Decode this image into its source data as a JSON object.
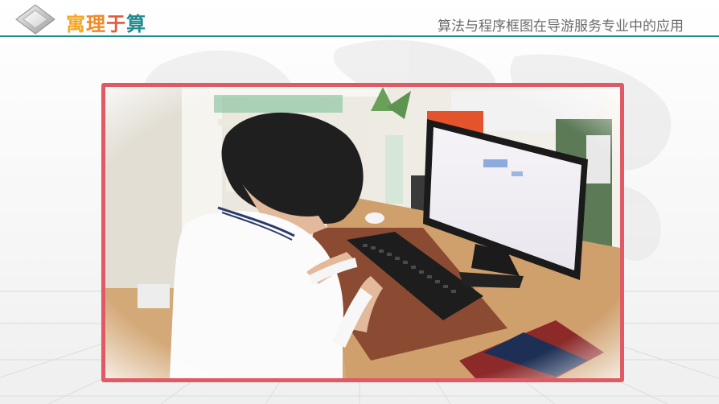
{
  "header": {
    "logo_chars": [
      "寓",
      "理",
      "于",
      "算"
    ],
    "page_title": "算法与程序框图在导游服务专业中的应用"
  },
  "photo": {
    "subject": "student-typing-at-computer"
  },
  "colors": {
    "accent_teal": "#1f8a8f",
    "frame_red": "#e05a66",
    "title_gray": "#6b6b6b"
  }
}
